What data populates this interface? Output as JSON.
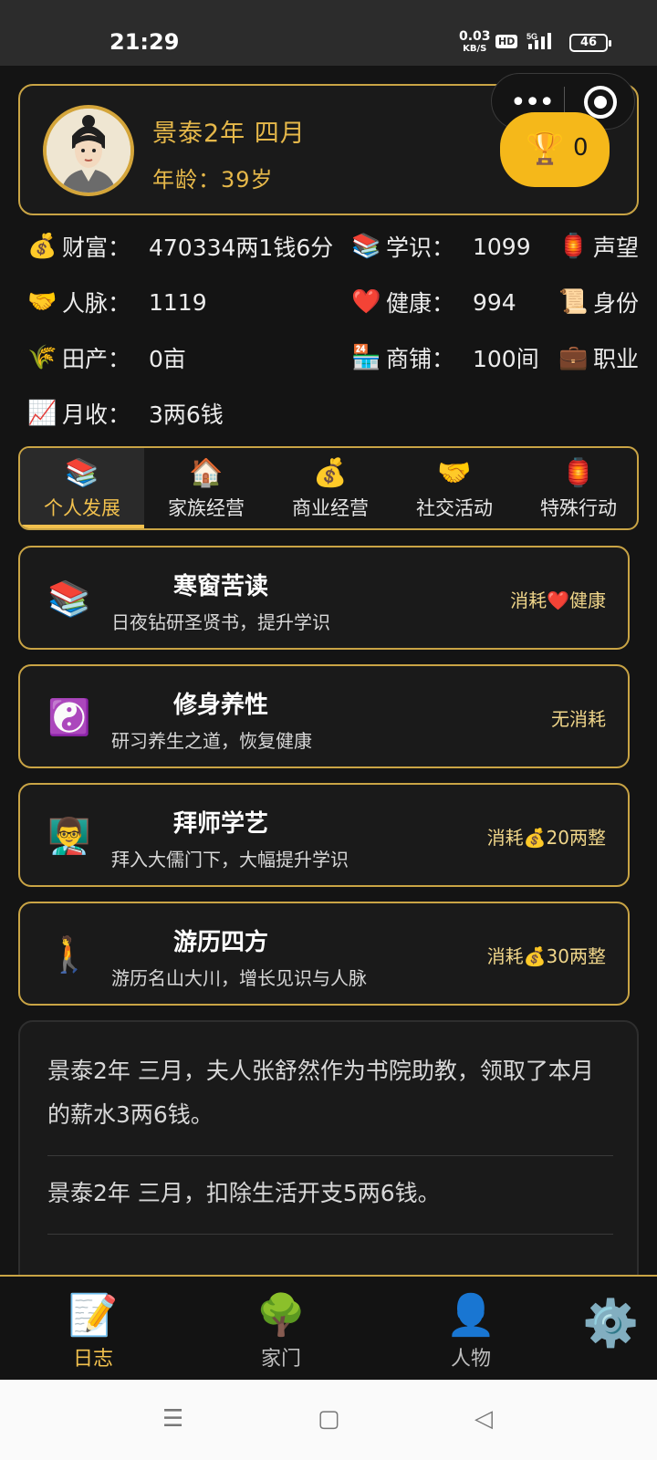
{
  "statusbar": {
    "time": "21:29",
    "speed": "0.03",
    "speed_unit": "KB/S",
    "hd": "HD",
    "net": "5G",
    "battery": "46"
  },
  "capsule": {
    "more_icon": "ellipsis-icon",
    "close_icon": "target-icon"
  },
  "profile": {
    "date": "景泰2年 四月",
    "age": "年龄：39岁",
    "trophy_count": "0"
  },
  "stats": {
    "wealth": {
      "icon": "💰",
      "label": "财富：",
      "value": "470334两1钱6分"
    },
    "knowledge": {
      "icon": "📚",
      "label": "学识：",
      "value": "1099"
    },
    "prestige": {
      "icon": "🏮",
      "label": "声望"
    },
    "connections": {
      "icon": "🤝",
      "label": "人脉：",
      "value": "1119"
    },
    "health": {
      "icon": "❤️",
      "label": "健康：",
      "value": "994"
    },
    "status": {
      "icon": "📜",
      "label": "身份"
    },
    "farmland": {
      "icon": "🌾",
      "label": "田产：",
      "value": "0亩"
    },
    "shops": {
      "icon": "🏪",
      "label": "商铺：",
      "value": "100间"
    },
    "career": {
      "icon": "💼",
      "label": "职业"
    },
    "income": {
      "icon": "📈",
      "label": "月收：",
      "value": "3两6钱"
    }
  },
  "tabs": [
    {
      "icon": "📚",
      "label": "个人发展"
    },
    {
      "icon": "🏠",
      "label": "家族经营"
    },
    {
      "icon": "💰",
      "label": "商业经营"
    },
    {
      "icon": "🤝",
      "label": "社交活动"
    },
    {
      "icon": "🏮",
      "label": "特殊行动"
    }
  ],
  "actions": [
    {
      "icon": "📚",
      "title": "寒窗苦读",
      "desc": "日夜钻研圣贤书，提升学识",
      "cost": "消耗❤️健康"
    },
    {
      "icon": "☯️",
      "title": "修身养性",
      "desc": "研习养生之道，恢复健康",
      "cost": "无消耗"
    },
    {
      "icon": "👨‍🏫",
      "title": "拜师学艺",
      "desc": "拜入大儒门下，大幅提升学识",
      "cost": "消耗💰20两整"
    },
    {
      "icon": "🚶",
      "title": "游历四方",
      "desc": "游历名山大川，增长见识与人脉",
      "cost": "消耗💰30两整"
    }
  ],
  "log": [
    "景泰2年 三月，夫人张舒然作为书院助教，领取了本月的薪水3两6钱。",
    "景泰2年 三月，扣除生活开支5两6钱。"
  ],
  "bottomnav": [
    {
      "icon": "📝",
      "label": "日志"
    },
    {
      "icon": "🌳",
      "label": "家门"
    },
    {
      "icon": "👤",
      "label": "人物"
    }
  ],
  "settings_icon": "⚙️",
  "sysnav": {
    "menu": "☰",
    "home": "▢",
    "back": "◁"
  }
}
